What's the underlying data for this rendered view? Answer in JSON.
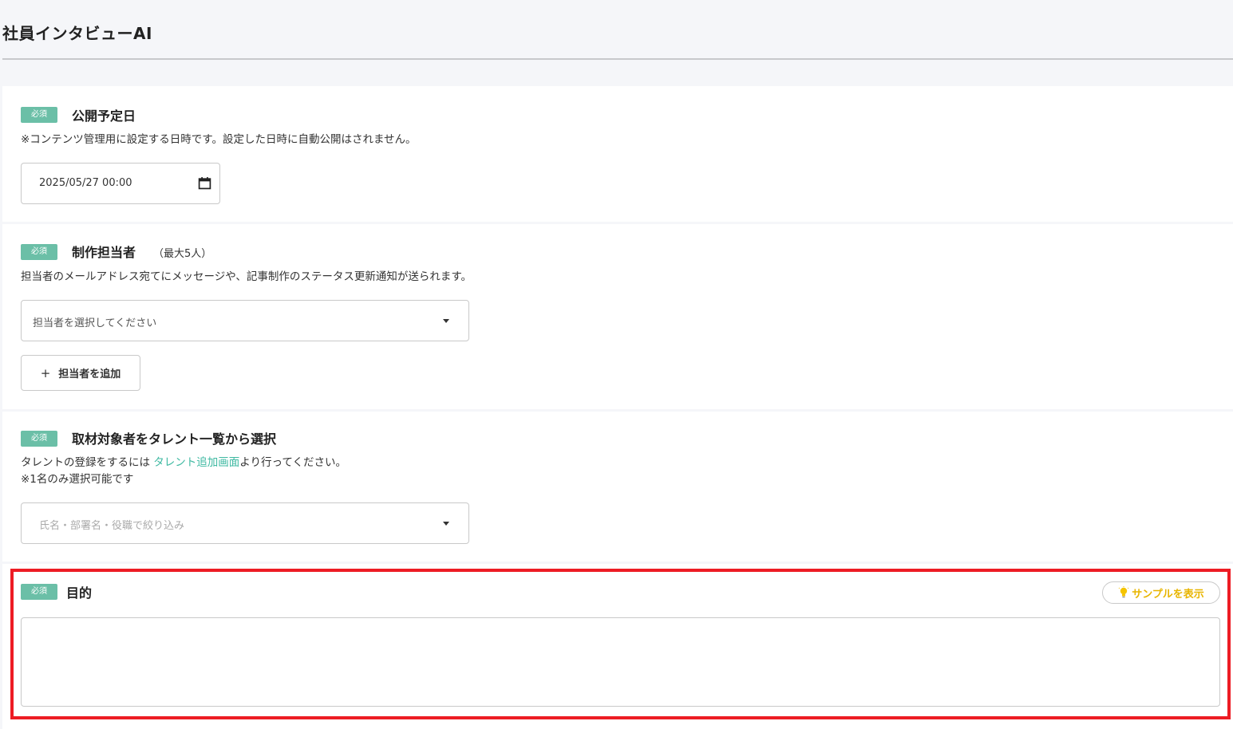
{
  "app": {
    "title": "社員インタビューAI"
  },
  "common": {
    "required_badge": "必須"
  },
  "publish_date": {
    "title": "公開予定日",
    "description": "※コンテンツ管理用に設定する日時です。設定した日時に自動公開はされません。",
    "value": "2025/05/27 00:00"
  },
  "assignees": {
    "title": "制作担当者",
    "limit_note": "（最大5人）",
    "description": "担当者のメールアドレス宛てにメッセージや、記事制作のステータス更新通知が送られます。",
    "select_placeholder": "担当者を選択してください",
    "add_button": "担当者を追加"
  },
  "interviewee": {
    "title": "取材対象者をタレント一覧から選択",
    "description_prefix": "タレントの登録をするには ",
    "description_link": "タレント追加画面",
    "description_suffix": "より行ってください。",
    "note": "※1名のみ選択可能です",
    "filter_placeholder": "氏名・部署名・役職で絞り込み"
  },
  "purpose": {
    "title": "目的",
    "sample_button": "サンプルを表示",
    "value": ""
  },
  "colors": {
    "badge": "#6bbfa7",
    "link": "#3fb9a2",
    "sample": "#e8b500",
    "highlight": "#ed1c24"
  },
  "icons": {
    "calendar": "calendar-icon",
    "dropdown": "caret-down-icon",
    "add": "plus-icon",
    "sample": "lightbulb-icon"
  }
}
